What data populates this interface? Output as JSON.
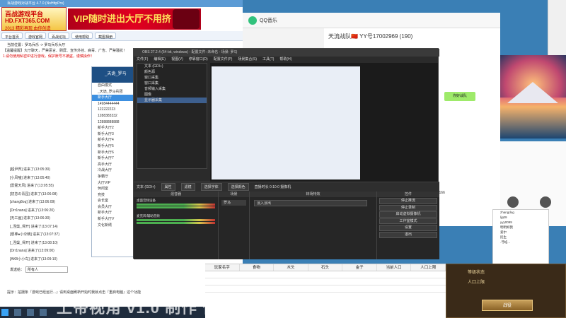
{
  "game": {
    "title": "百战游戏对战平台 4.7.0 (NoHttpPro)",
    "logo_line1": "百战游戏平台",
    "logo_line2": "HD.FXT365.COM",
    "logo_line3": "2013 精彩再现 由你创造",
    "banner": "VIP随时进出大厅不用挤",
    "nav": [
      "平台首页",
      "游戏官网",
      "百战论坛",
      "使用帮助",
      "截图相册"
    ],
    "breadcrumb": "当前位置：罗马兵乐 -> 罗马兵乐大厅",
    "notice1": "【温馨提醒】大厅聊天，严禁恶言、刷屏、宣传外挂、病毒、广告、严禁骚扰！",
    "notice2": "1.请勿使用私密IP进行游戏，保护账号不被盗，谨慎操作！",
    "chat_log": [
      "[超尹界] 进来了(13:05:30)",
      "[小风嗑] 进来了(13:05:40)",
      "[雷霆天风] 进来了(13:05:55)",
      "[初恋の青园] 进来了(13:06:08)",
      "[zhang8oq] 进来了(13:06:09)",
      "[Drr1nana] 进来了(13:06:20)",
      "[无工画] 进来了(13:06:30)",
      "[_涅槃_帰开] 进来了(13:07:14)",
      "[很棒●小伞精] 进来了(13:07:37)",
      "[_涅槃_帰开] 进来了(13:08:10)",
      "[Drr1nana] 进来了(13:09:00)",
      "[AKB小小鸟] 进来了(13:09:10)",
      "[无工画] 进来了(13:09:15)"
    ],
    "chat_label": "发送给：",
    "chat_target": "所有人",
    "tip": "提示：拍摄条『游戏已经运行...』请到桌面刷新开始时我就点击『重启电脑』这个功能"
  },
  "lobby": {
    "header": "_天诡_罗马",
    "items": [
      "自由模式",
      "_天诡_罗马兵团",
      "新手大厅",
      "新手大厅1",
      "14984444444",
      "122222223",
      "1288383332",
      "12888888888",
      "新手大厅2",
      "新手大厅3",
      "新手大厅4",
      "新手大厅5",
      "新手大厅6",
      "新手大厅7",
      "高手大厅",
      "冷战大厅",
      "争霸厅",
      "大厅VIP",
      "休闲室",
      "竞技",
      "会长室",
      "会员大厅",
      "新手大厅",
      "新手大厅V",
      "文化新绣"
    ]
  },
  "qq": {
    "app": "QQ音乐",
    "chat_name": "天流战队🇨🇳 YY号17002969 (190)",
    "bubble": "你好战队",
    "link": "/4260166",
    "side_labels": [
      "禁音",
      "静音"
    ]
  },
  "obs": {
    "title": "OBS 27.2.4 (64-bit, windows) - 配置文件: 未命名 - 场景: 罗马",
    "menu": [
      "文件(F)",
      "编辑(E)",
      "视图(V)",
      "停靠窗口(D)",
      "配置文件(P)",
      "场景集合(S)",
      "工具(T)",
      "帮助(H)"
    ],
    "sources": [
      "文本 (GDI+)",
      "颜色源",
      "窗口采集",
      "窗口采集",
      "音频输入采集",
      "图像",
      "显示器采集"
    ],
    "toolbar": [
      "属性",
      "滤镜",
      "选择字体",
      "选择颜色"
    ],
    "toolbar_text": "文本 (GDI+)",
    "status": "直播时长 0:10:0 摄像机",
    "mixer_head": "混音器",
    "mixer": [
      "桌面音频设备",
      "麦克风/辅助音频"
    ],
    "scenes_head": "场景",
    "scene": "罗马",
    "trans_head": "转场特效",
    "trans_sel": "淡入淡出",
    "controls_head": "控件",
    "controls": [
      "停止推流",
      "停止录制",
      "启动虚拟摄像机",
      "工作室模式",
      "设置",
      "退出"
    ]
  },
  "sheet": {
    "headers": [
      "玩家名字",
      "食物",
      "木头",
      "石头",
      "金子",
      "当前人口",
      "人口上限"
    ]
  },
  "users": [
    "zhangdog",
    "ljq09",
    "yyy0099",
    "明明如我",
    "爱尔",
    "民生",
    ".弓蛙..."
  ],
  "panel": {
    "label1": "等级状态",
    "label2": "人口上限",
    "button": "战役"
  },
  "watermark": "上帝视角 v1.0 制作 作者"
}
